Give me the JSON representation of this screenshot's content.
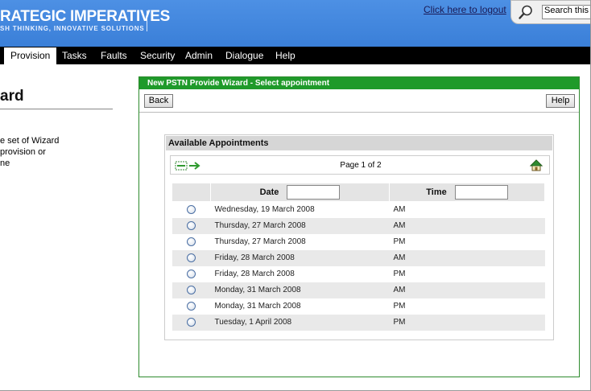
{
  "brand": {
    "title": "RATEGIC IMPERATIVES",
    "tagline": "SH THINKING, INNOVATIVE SOLUTIONS",
    "header_color": "#3a7fd8"
  },
  "header": {
    "logout_label": "Click here to logout",
    "search_value": "Search this po",
    "search_icon": "search-icon"
  },
  "nav": {
    "items": [
      {
        "label": "Provision",
        "active": true
      },
      {
        "label": "Tasks"
      },
      {
        "label": "Faults"
      },
      {
        "label": "Security"
      },
      {
        "label": "Admin"
      },
      {
        "label": "Dialogue"
      },
      {
        "label": "Help"
      }
    ]
  },
  "left": {
    "title": "ard",
    "desc_lines": [
      "e set of Wizard",
      "provision or",
      "ne"
    ]
  },
  "wizard": {
    "title": "New PSTN Provide Wizard - Select appointment",
    "back_label": "Back",
    "help_label": "Help",
    "accent": "#1f9a2a"
  },
  "appointments": {
    "title": "Available Appointments",
    "page_label": "Page 1 of 2",
    "icons": [
      "first-page-icon",
      "next-page-icon",
      "home-icon"
    ],
    "columns": {
      "date": "Date",
      "time": "Time"
    },
    "rows": [
      {
        "date": "Wednesday, 19 March 2008",
        "time": "AM"
      },
      {
        "date": "Thursday, 27 March 2008",
        "time": "AM"
      },
      {
        "date": "Thursday, 27 March 2008",
        "time": "PM"
      },
      {
        "date": "Friday, 28 March 2008",
        "time": "AM"
      },
      {
        "date": "Friday, 28 March 2008",
        "time": "PM"
      },
      {
        "date": "Monday, 31 March 2008",
        "time": "AM"
      },
      {
        "date": "Monday, 31 March 2008",
        "time": "PM"
      },
      {
        "date": "Tuesday, 1 April 2008",
        "time": "PM"
      }
    ]
  }
}
